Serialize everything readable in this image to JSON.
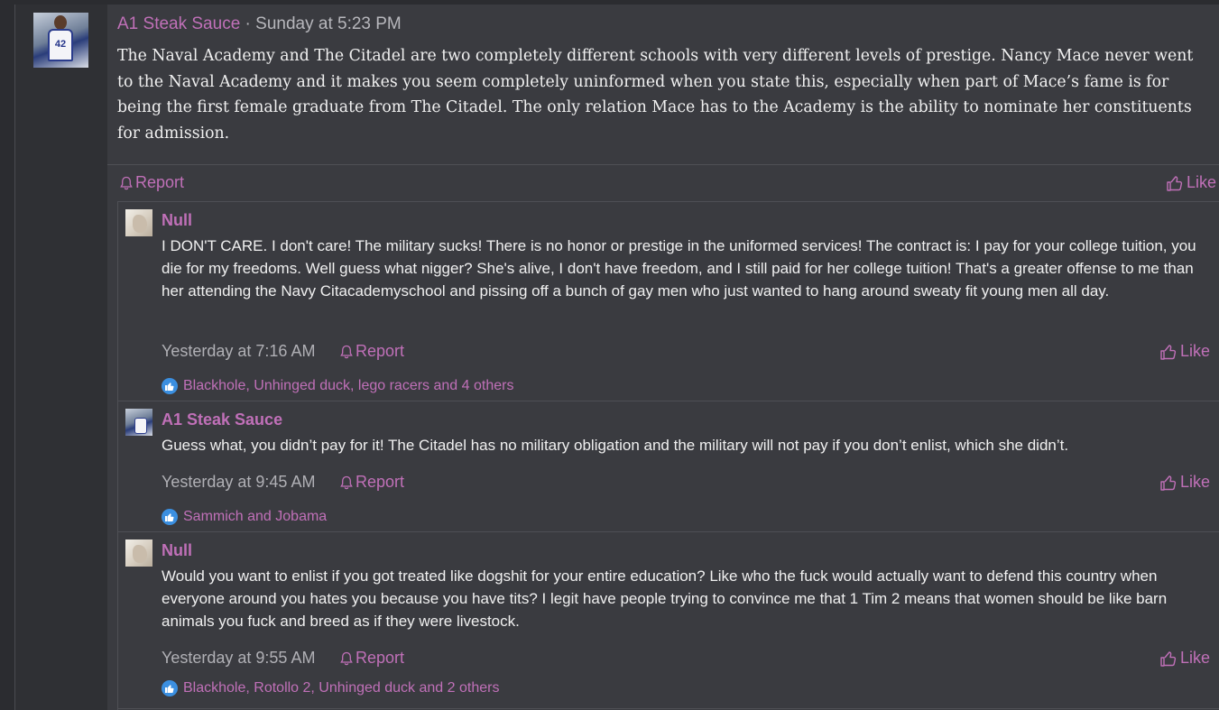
{
  "post": {
    "author": "A1 Steak Sauce",
    "separator": " · ",
    "timestamp": "Sunday at 5:23 PM",
    "body": "The Naval Academy and The Citadel are two completely different schools with very different levels of prestige. Nancy Mace never went to the Naval Academy and it makes you seem completely uninformed when you state this, especially when part of Mace’s fame is for being the first female graduate from The Citadel. The only relation Mace has to the Academy is the ability to nominate her constituents for admission.",
    "report_label": "Report",
    "like_label": "Like"
  },
  "replies": [
    {
      "author": "Null",
      "avatar": "null-avatar",
      "text": "I DON'T CARE. I don't care! The military sucks! There is no honor or prestige in the uniformed services! The contract is: I pay for your college tuition, you die for my freedoms. Well guess what nigger? She's alive, I don't have freedom, and I still paid for her college tuition! That's a greater offense to me than her attending the Navy Citacademyschool and pissing off a bunch of gay men who just wanted to hang around sweaty fit young men all day.",
      "time": "Yesterday at 7:16 AM",
      "report_label": "Report",
      "like_label": "Like",
      "reactions": "Blackhole, Unhinged duck, lego racers and 4 others"
    },
    {
      "author": "A1 Steak Sauce",
      "avatar": "a1-avatar",
      "text": "Guess what, you didn’t pay for it! The Citadel has no military obligation and the military will not pay if you don’t enlist, which she didn’t.",
      "time": "Yesterday at 9:45 AM",
      "report_label": "Report",
      "like_label": "Like",
      "reactions": "Sammich and Jobama"
    },
    {
      "author": "Null",
      "avatar": "null-avatar",
      "text": "Would you want to enlist if you got treated like dogshit for your entire education? Like who the fuck would actually want to defend this country when everyone around you hates you because you have tits? I legit have people trying to convince me that 1 Tim 2 means that women should be like barn animals you fuck and breed as if they were livestock.",
      "time": "Yesterday at 9:55 AM",
      "report_label": "Report",
      "like_label": "Like",
      "reactions": "Blackhole, Rotollo 2, Unhinged duck and 2 others"
    }
  ],
  "colors": {
    "accent": "#c070b8",
    "background": "#3a3b40",
    "sidebar": "#2f3034",
    "reaction_badge": "#3b8fe0"
  },
  "icons": {
    "report": "bell-icon",
    "like": "thumbs-up-icon",
    "reaction": "like-reaction-icon"
  }
}
